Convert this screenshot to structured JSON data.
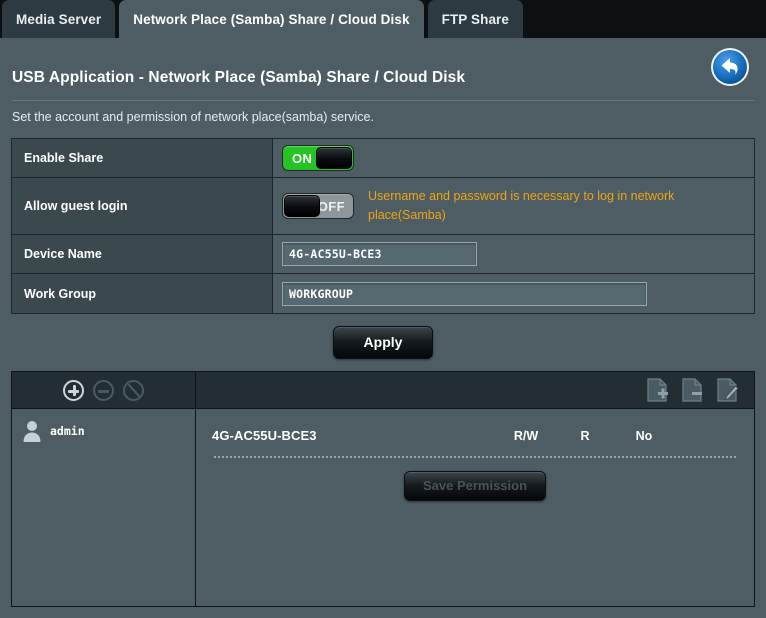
{
  "tabs": [
    {
      "label": "Media Server",
      "active": false
    },
    {
      "label": "Network Place (Samba) Share / Cloud Disk",
      "active": true
    },
    {
      "label": "FTP Share",
      "active": false
    }
  ],
  "header": {
    "title": "USB Application - Network Place (Samba) Share / Cloud Disk",
    "subtitle": "Set the account and permission of network place(samba) service.",
    "back_icon": "back-arrow-icon",
    "back_color": "#1566b0"
  },
  "settings": {
    "enable_share": {
      "label": "Enable Share",
      "state": "ON",
      "on_color": "#25c425"
    },
    "allow_guest_login": {
      "label": "Allow guest login",
      "state": "OFF",
      "warning": "Username and password is necessary to log in network place(Samba)",
      "warning_color": "#f0a417"
    },
    "device_name": {
      "label": "Device Name",
      "value": "4G-AC55U-BCE3",
      "placeholder": ""
    },
    "work_group": {
      "label": "Work Group",
      "value": "WORKGROUP",
      "placeholder": ""
    }
  },
  "apply_button": {
    "label": "Apply"
  },
  "share_panel": {
    "toolbar": {
      "user_actions": [
        {
          "name": "add-user-icon",
          "label": "Add user",
          "enabled": true
        },
        {
          "name": "remove-user-icon",
          "label": "Remove user",
          "enabled": false
        },
        {
          "name": "edit-user-icon",
          "label": "Edit user",
          "enabled": false
        }
      ],
      "folder_actions": [
        {
          "name": "add-folder-icon",
          "label": "Add folder"
        },
        {
          "name": "remove-folder-icon",
          "label": "Remove folder"
        },
        {
          "name": "edit-folder-icon",
          "label": "Edit folder"
        }
      ]
    },
    "users": [
      {
        "name": "admin",
        "icon": "user-avatar-icon"
      }
    ],
    "folder_row": {
      "folder_name": "4G-AC55U-BCE3",
      "permissions": [
        "R/W",
        "R",
        "No"
      ]
    },
    "save_permission_button": {
      "label": "Save Permission",
      "enabled": false
    }
  }
}
